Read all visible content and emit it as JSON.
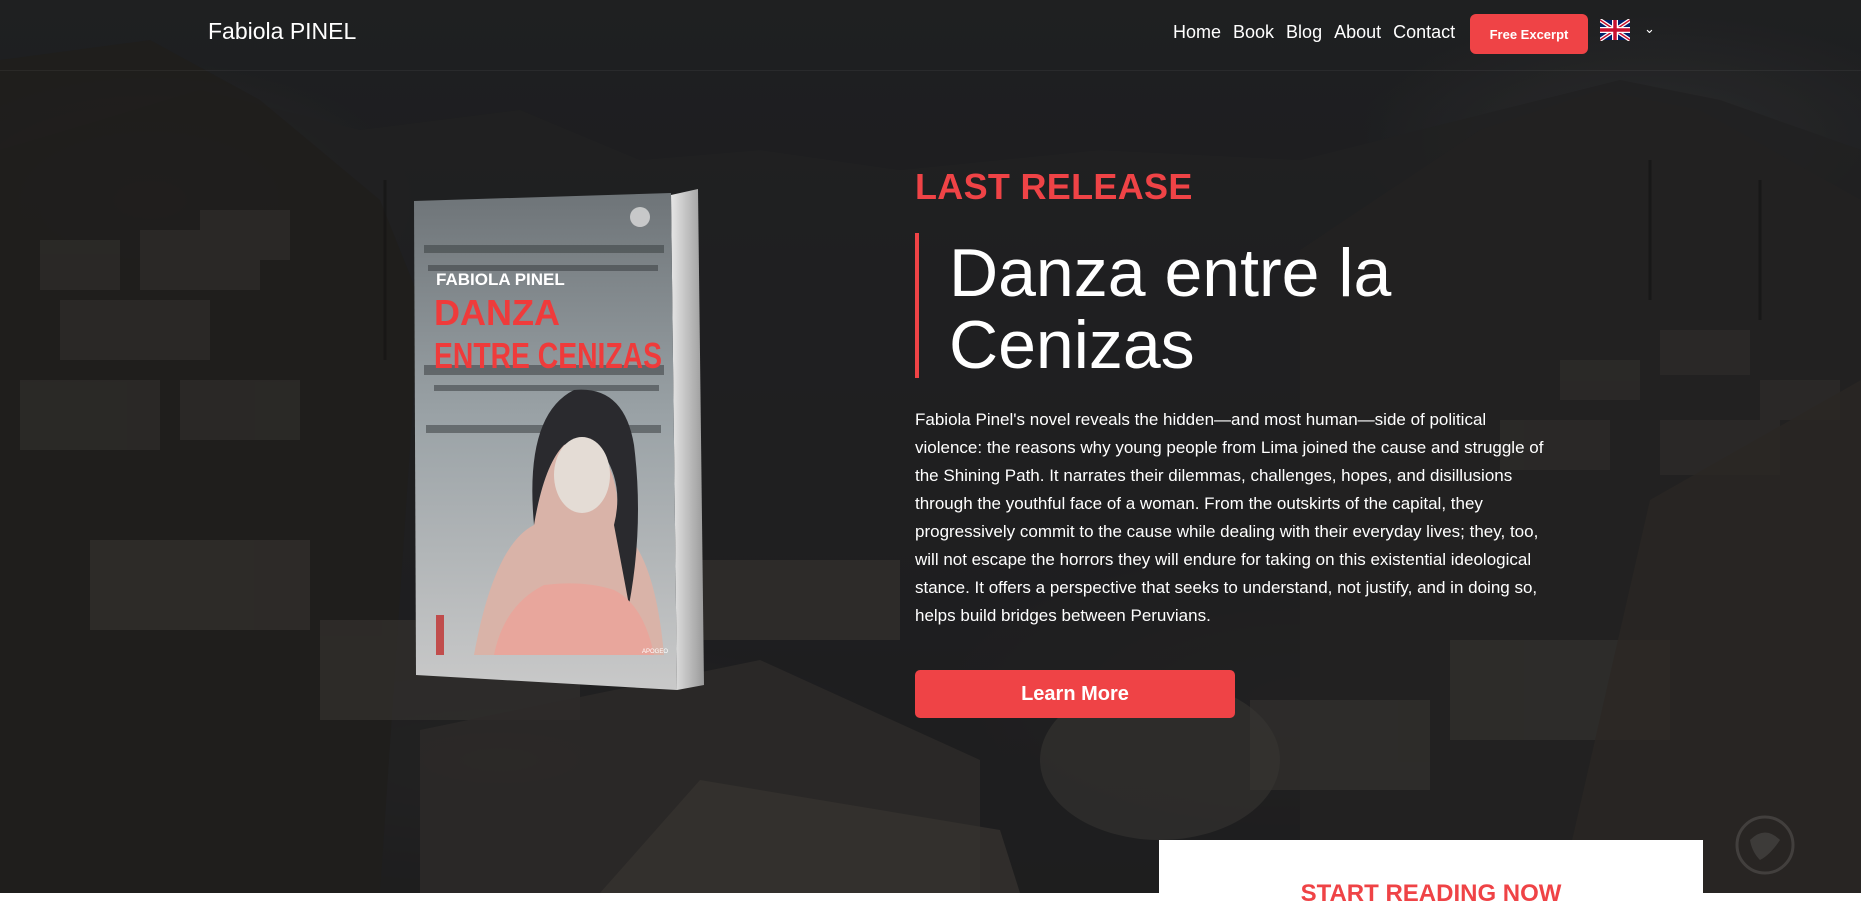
{
  "brand": {
    "name": "Fabiola PINEL"
  },
  "nav": {
    "items": [
      {
        "label": "Home"
      },
      {
        "label": "Book"
      },
      {
        "label": "Blog"
      },
      {
        "label": "About"
      },
      {
        "label": "Contact"
      }
    ],
    "cta_label": "Free Excerpt",
    "language": {
      "icon": "uk-flag-icon",
      "caret": "chevron-down-icon"
    }
  },
  "book_cover": {
    "author": "FABIOLA PINEL",
    "title_line1": "DANZA",
    "title_line2": "ENTRE CENIZAS",
    "publisher": "APOGEO"
  },
  "hero": {
    "eyebrow": "LAST RELEASE",
    "title": "Danza entre la Cenizas",
    "description": "Fabiola Pinel's novel reveals the hidden—and most human—side of political violence: the reasons why young people from Lima joined the cause and struggle of the Shining Path. It narrates their dilemmas, challenges, hopes, and disillusions through the youthful face of a woman. From the outskirts of the capital, they progressively commit to the cause while dealing with their everyday lives; they, too, will not escape the horrors they will endure for taking on this existential ideological stance. It offers a perspective that seeks to understand, not justify, and in doing so, helps build bridges between Peruvians.",
    "button_label": "Learn More"
  },
  "reading_card": {
    "label": "START READING NOW"
  },
  "colors": {
    "accent": "#ef4346",
    "background": "#232325",
    "text": "#ffffff"
  }
}
